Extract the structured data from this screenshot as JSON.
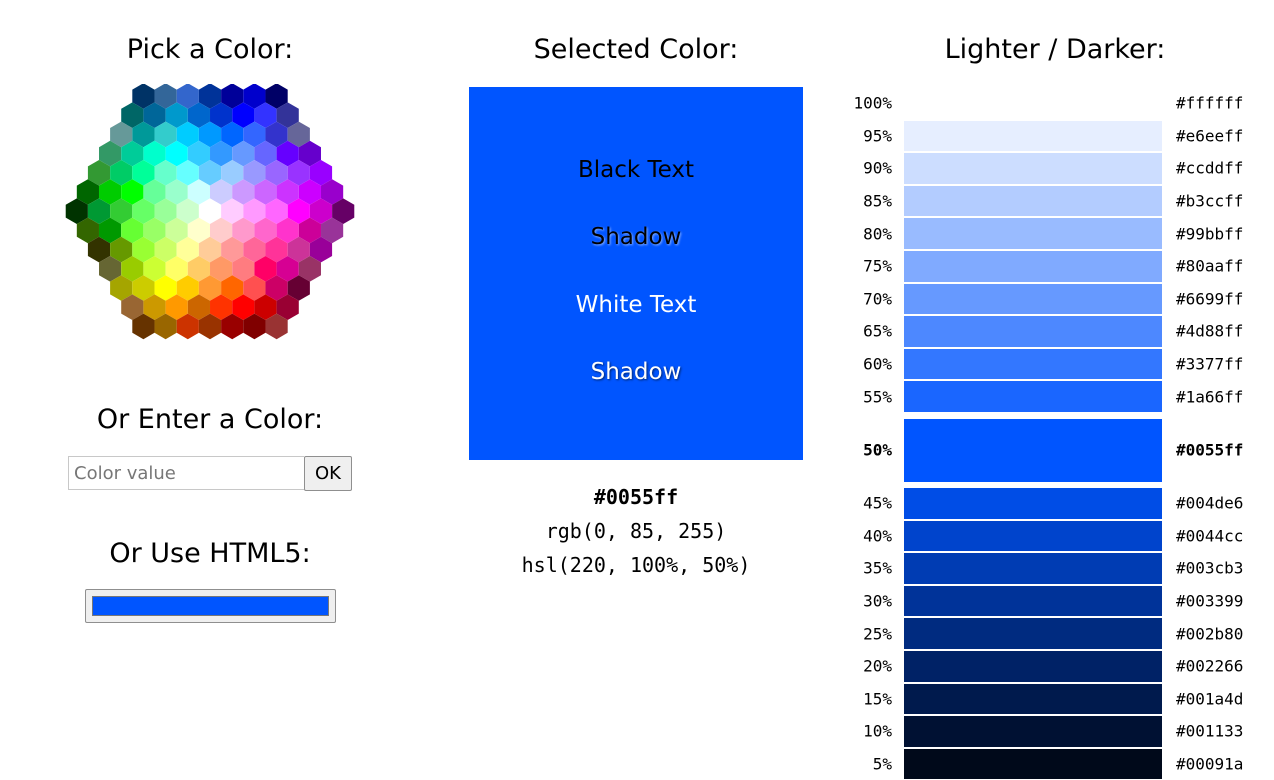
{
  "pick": {
    "title": "Pick a Color:",
    "hexagons": [
      [
        "#003366",
        "#336699",
        "#3366cc",
        "#003399",
        "#000099",
        "#0000cc",
        "#000066"
      ],
      [
        "#006666",
        "#006699",
        "#0099cc",
        "#0066cc",
        "#0033cc",
        "#0000ff",
        "#3333ff",
        "#333399"
      ],
      [
        "#669999",
        "#009999",
        "#33cccc",
        "#00ccff",
        "#0099ff",
        "#0066ff",
        "#3366ff",
        "#3333cc",
        "#666699"
      ],
      [
        "#339966",
        "#00cc99",
        "#00ffcc",
        "#00ffff",
        "#33ccff",
        "#3399ff",
        "#6699ff",
        "#6666ff",
        "#6600ff",
        "#6600cc"
      ],
      [
        "#339933",
        "#00cc66",
        "#00ff99",
        "#66ffcc",
        "#66ffff",
        "#66ccff",
        "#99ccff",
        "#9999ff",
        "#9966ff",
        "#9933ff",
        "#9900ff"
      ],
      [
        "#006600",
        "#00cc00",
        "#00ff00",
        "#66ff99",
        "#99ffcc",
        "#ccffff",
        "#ccccff",
        "#cc99ff",
        "#cc66ff",
        "#cc33ff",
        "#cc00ff",
        "#9900cc"
      ],
      [
        "#003300",
        "#009933",
        "#33cc33",
        "#66ff66",
        "#99ff99",
        "#ccffcc",
        "#ffffff",
        "#ffccff",
        "#ff99ff",
        "#ff66ff",
        "#ff00ff",
        "#cc00cc",
        "#660066"
      ],
      [
        "#336600",
        "#009900",
        "#66ff33",
        "#99ff66",
        "#ccff99",
        "#ffffcc",
        "#ffcccc",
        "#ff99cc",
        "#ff66cc",
        "#ff33cc",
        "#cc0099",
        "#993399"
      ],
      [
        "#333300",
        "#669900",
        "#99ff33",
        "#ccff66",
        "#ffff99",
        "#ffcc99",
        "#ff9999",
        "#ff6699",
        "#ff3399",
        "#cc3399",
        "#990099"
      ],
      [
        "#666633",
        "#99cc00",
        "#ccff33",
        "#ffff66",
        "#ffcc66",
        "#ff9966",
        "#ff7c80",
        "#ff0066",
        "#d60093",
        "#993366"
      ],
      [
        "#a5a500",
        "#cccc00",
        "#ffff00",
        "#ffcc00",
        "#ff9933",
        "#ff6600",
        "#ff5050",
        "#cc0066",
        "#660033"
      ],
      [
        "#996633",
        "#cc9900",
        "#ff9900",
        "#cc6600",
        "#ff3300",
        "#ff0000",
        "#cc0000",
        "#990033"
      ],
      [
        "#663300",
        "#996600",
        "#cc3300",
        "#993300",
        "#990000",
        "#800000",
        "#993333"
      ]
    ]
  },
  "enter": {
    "title": "Or Enter a Color:",
    "input_value": "",
    "input_placeholder": "Color value",
    "ok_label": "OK"
  },
  "html5": {
    "title": "Or Use HTML5:",
    "value": "#0055ff"
  },
  "selected": {
    "title": "Selected Color:",
    "color": "#0055ff",
    "black_text": "Black Text",
    "black_shadow": "Shadow",
    "white_text": "White Text",
    "white_shadow": "Shadow",
    "hex": "#0055ff",
    "rgb": "rgb(0, 85, 255)",
    "hsl": "hsl(220, 100%, 50%)"
  },
  "shades": {
    "title": "Lighter / Darker:",
    "rows": [
      {
        "pct": "100%",
        "hex": "#ffffff"
      },
      {
        "pct": "95%",
        "hex": "#e6eeff"
      },
      {
        "pct": "90%",
        "hex": "#ccddff"
      },
      {
        "pct": "85%",
        "hex": "#b3ccff"
      },
      {
        "pct": "80%",
        "hex": "#99bbff"
      },
      {
        "pct": "75%",
        "hex": "#80aaff"
      },
      {
        "pct": "70%",
        "hex": "#6699ff"
      },
      {
        "pct": "65%",
        "hex": "#4d88ff"
      },
      {
        "pct": "60%",
        "hex": "#3377ff"
      },
      {
        "pct": "55%",
        "hex": "#1a66ff"
      },
      {
        "pct": "50%",
        "hex": "#0055ff",
        "current": true
      },
      {
        "pct": "45%",
        "hex": "#004de6"
      },
      {
        "pct": "40%",
        "hex": "#0044cc"
      },
      {
        "pct": "35%",
        "hex": "#003cb3"
      },
      {
        "pct": "30%",
        "hex": "#003399"
      },
      {
        "pct": "25%",
        "hex": "#002b80"
      },
      {
        "pct": "20%",
        "hex": "#002266"
      },
      {
        "pct": "15%",
        "hex": "#001a4d"
      },
      {
        "pct": "10%",
        "hex": "#001133"
      },
      {
        "pct": "5%",
        "hex": "#00091a"
      }
    ]
  }
}
